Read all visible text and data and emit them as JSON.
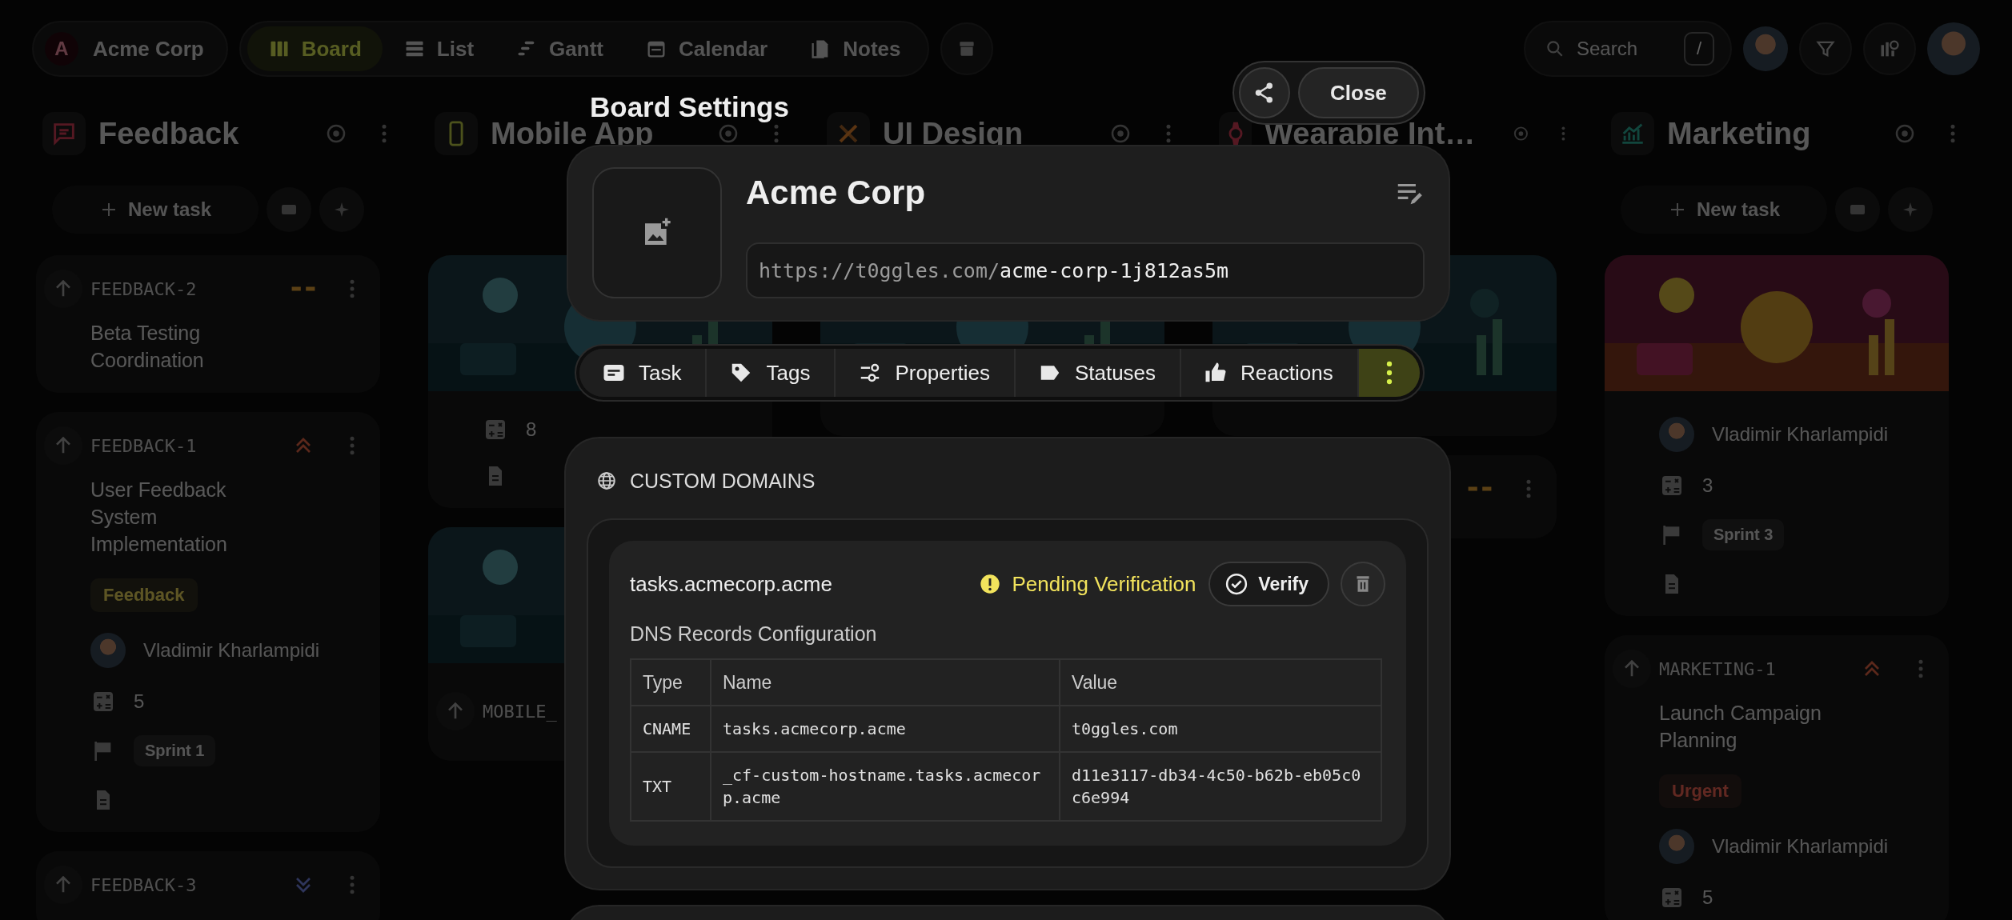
{
  "topbar": {
    "workspace": {
      "initial": "A",
      "name": "Acme Corp"
    },
    "views": [
      {
        "label": "Board",
        "selected": true
      },
      {
        "label": "List",
        "selected": false
      },
      {
        "label": "Gantt",
        "selected": false
      },
      {
        "label": "Calendar",
        "selected": false
      },
      {
        "label": "Notes",
        "selected": false
      }
    ],
    "search": {
      "placeholder": "Search",
      "shortcut": "/"
    }
  },
  "columns": [
    {
      "title": "Feedback",
      "new_task": "New task",
      "cards": [
        {
          "key": "FEEDBACK-2",
          "priority": {
            "kind": "none"
          },
          "title": "Beta Testing Coordination"
        },
        {
          "key": "FEEDBACK-1",
          "priority": {
            "kind": "high"
          },
          "title": "User Feedback System Implementation",
          "tag": {
            "label": "Feedback",
            "kind": "feedback"
          },
          "assignee": "Vladimir Kharlampidi",
          "points": "5",
          "sprint": "Sprint 1",
          "doc": true
        },
        {
          "key": "FEEDBACK-3",
          "priority": {
            "kind": "low"
          }
        }
      ]
    },
    {
      "title": "Mobile App",
      "cards": [
        {
          "picture": true,
          "points": "8",
          "doc": true
        },
        {
          "picture": true,
          "key": "MOBILE_"
        }
      ]
    },
    {
      "title": "UI Design",
      "cards": [
        {
          "picture": true
        }
      ]
    },
    {
      "title": "Wearable Int…",
      "cards": [
        {
          "picture": true
        },
        {
          "priority": {
            "kind": "none"
          }
        }
      ]
    },
    {
      "title": "Marketing",
      "new_task": "New task",
      "cards": [
        {
          "picture": true,
          "assignee": "Vladimir Kharlampidi",
          "points": "3",
          "sprint": "Sprint 3",
          "doc": true
        },
        {
          "key": "MARKETING-1",
          "priority": {
            "kind": "high"
          },
          "title": "Launch Campaign Planning",
          "tag": {
            "label": "Urgent",
            "kind": "urgent"
          },
          "assignee": "Vladimir Kharlampidi",
          "points": "5"
        }
      ]
    }
  ],
  "modal": {
    "title": "Board Settings",
    "close": "Close",
    "board": {
      "name": "Acme Corp",
      "url_prefix": "https://t0ggles.com/",
      "url_slug": "acme-corp-1j812as5m"
    },
    "tabs": [
      {
        "label": "Task",
        "selected": false
      },
      {
        "label": "Tags",
        "selected": false
      },
      {
        "label": "Properties",
        "selected": false
      },
      {
        "label": "Statuses",
        "selected": false
      },
      {
        "label": "Reactions",
        "selected": false
      },
      {
        "selected": true
      }
    ],
    "custom_domains": {
      "heading": "CUSTOM DOMAINS",
      "domains": [
        {
          "host": "tasks.acmecorp.acme",
          "status": {
            "label": "Pending Verification",
            "kind": "pending"
          },
          "verify": "Verify",
          "dns_title": "DNS Records Configuration",
          "columns": [
            "Type",
            "Name",
            "Value"
          ],
          "records": [
            [
              "CNAME",
              "tasks.acmecorp.acme",
              "t0ggles.com"
            ],
            [
              "TXT",
              "_cf-custom-hostname.tasks.acmecorp.acme",
              "d11e3117-db34-4c50-b62b-eb05c0c6e994"
            ]
          ]
        }
      ]
    }
  }
}
